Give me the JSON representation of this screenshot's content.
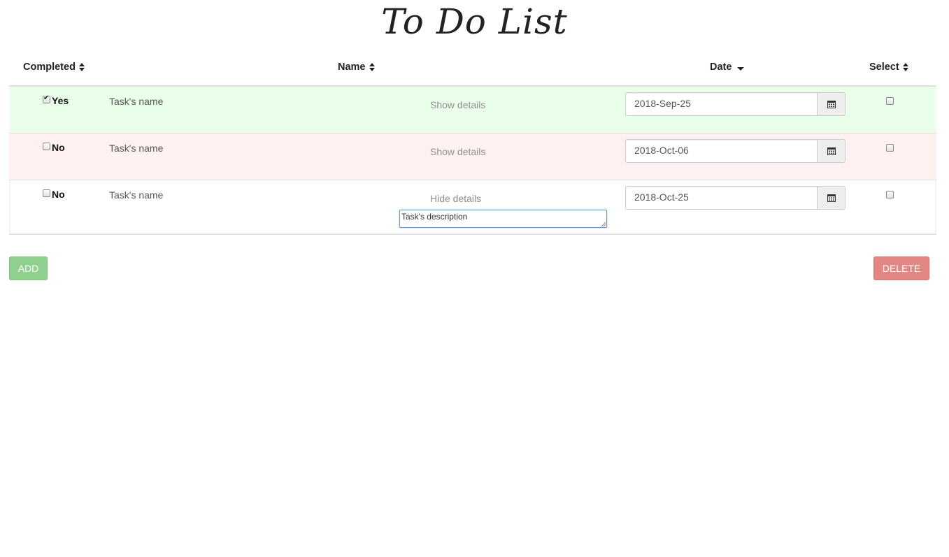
{
  "title": "To Do List",
  "columns": {
    "completed": "Completed",
    "name": "Name",
    "date": "Date",
    "select": "Select"
  },
  "tasks": [
    {
      "completed": true,
      "completed_label": "Yes",
      "name": "Task's name",
      "details_label": "Show details",
      "date": "2018-Sep-25",
      "selected": false,
      "status": "success"
    },
    {
      "completed": false,
      "completed_label": "No",
      "name": "Task's name",
      "details_label": "Show details",
      "date": "2018-Oct-06",
      "selected": false,
      "status": "danger"
    },
    {
      "completed": false,
      "completed_label": "No",
      "name": "Task's name",
      "details_label": "Hide details",
      "date": "2018-Oct-25",
      "selected": false,
      "status": "default",
      "description": "Task's description"
    }
  ],
  "buttons": {
    "add": "ADD",
    "delete": "DELETE"
  },
  "colors": {
    "success_row": "#eaffea",
    "danger_row": "#fff1f1",
    "add_button": "#8fd08f",
    "delete_button": "#e38785"
  },
  "icons": {
    "sort": "sort-icon",
    "sort_desc": "caret-down-icon",
    "calendar": "calendar-icon"
  }
}
